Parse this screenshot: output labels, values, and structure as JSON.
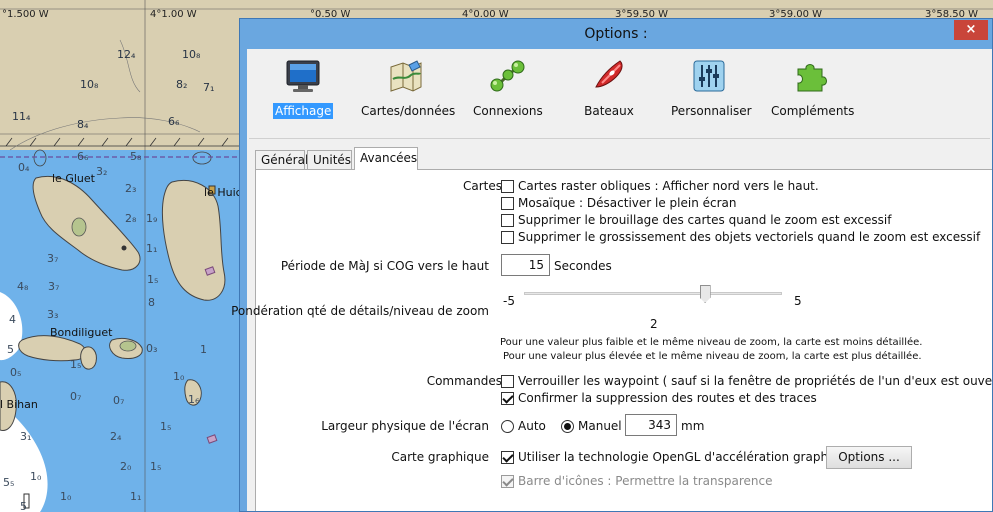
{
  "chart_bg": {
    "coords": [
      "°1.500 W",
      "4°1.00 W",
      "°0.50 W",
      "4°0.00 W",
      "3°59.50 W",
      "3°59.00 W",
      "3°58.50 W"
    ],
    "places": [
      "le Gluet",
      "le Huic",
      "Bondiliguet",
      "l Bihan"
    ],
    "depths": [
      "12₄",
      "10₈",
      "10₈",
      "8₂",
      "7₁",
      "11₄",
      "8₄",
      "6₆",
      "6₆",
      "5₈",
      "0₄",
      "3₂",
      "2₃",
      "2₈",
      "1₉",
      "1₁",
      "3₇",
      "1₅",
      "4₈",
      "8",
      "3₇",
      "3₃",
      "4",
      "5",
      "0₃",
      "1",
      "0₇",
      "0₅",
      "0₇",
      "1₀",
      "1₅",
      "1₆",
      "1₅",
      "2₄",
      "3₁",
      "2₀",
      "1₁",
      "1₀",
      "1₅",
      "5₅",
      "1₀",
      "5"
    ],
    "colors": {
      "land": "#d9cfb1",
      "shallow": "#6fb2ea",
      "deep": "#ffffff",
      "drying": "#b5c48e"
    }
  },
  "dialog": {
    "title": "Options :",
    "close_icon": "×",
    "toolbar": [
      {
        "label": "Affichage",
        "icon": "monitor-icon",
        "active": true
      },
      {
        "label": "Cartes/données",
        "icon": "charts-icon",
        "active": false
      },
      {
        "label": "Connexions",
        "icon": "network-icon",
        "active": false
      },
      {
        "label": "Bateaux",
        "icon": "boat-icon",
        "active": false
      },
      {
        "label": "Personnaliser",
        "icon": "sliders-icon",
        "active": false
      },
      {
        "label": "Compléments",
        "icon": "puzzle-icon",
        "active": false
      }
    ],
    "tabs": [
      {
        "label": "Général",
        "active": false
      },
      {
        "label": "Unités",
        "active": false
      },
      {
        "label": "Avancées",
        "active": true
      }
    ],
    "advanced": {
      "cartes_label": "Cartes",
      "cartes_options": [
        {
          "label": "Cartes raster obliques : Afficher nord vers le haut.",
          "checked": false
        },
        {
          "label": "Mosaïque : Désactiver le plein écran",
          "checked": false
        },
        {
          "label": "Supprimer le brouillage des cartes quand le zoom est excessif",
          "checked": false
        },
        {
          "label": "Supprimer le grossissement des objets vectoriels quand le zoom est excessif",
          "checked": false
        }
      ],
      "cog_label": "Période de MàJ si COG vers le haut",
      "cog_value": "15",
      "cog_unit": "Secondes",
      "zoom_label": "Pondération qté de détails/niveau de zoom",
      "zoom_min": "-5",
      "zoom_max": "5",
      "zoom_value": "2",
      "zoom_fraction": 0.7,
      "zoom_note_1": "Pour une valeur plus faible et le même niveau de zoom, la carte est moins détaillée.",
      "zoom_note_2": "Pour une valeur plus élevée et le même niveau de zoom, la carte est plus détaillée.",
      "commandes_label": "Commandes",
      "commandes_options": [
        {
          "label": "Verrouiller les waypoint ( sauf si la fenêtre de propriétés de l'un d'eux est ouverte)",
          "checked": false
        },
        {
          "label": "Confirmer la suppression des routes et des traces",
          "checked": true
        }
      ],
      "ecran_label": "Largeur physique de l'écran",
      "ecran_auto": "Auto",
      "ecran_manuel": "Manuel :",
      "ecran_value": "343",
      "ecran_unit": "mm",
      "graphique_label": "Carte graphique",
      "opengl_label": "Utiliser la technologie OpenGL d'accélération graphique",
      "opengl_checked": true,
      "options_button": "Options ...",
      "barre_label": "Barre d'icônes : Permettre la transparence",
      "barre_checked": true
    }
  }
}
